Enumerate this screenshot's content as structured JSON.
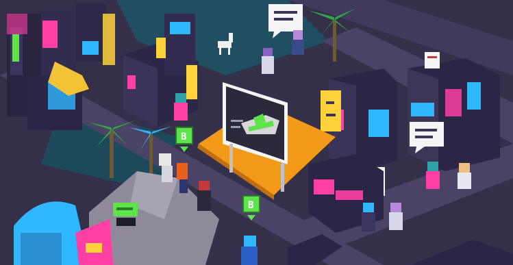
{
  "scene": {
    "style": "isometric pixel-art cyberpunk city",
    "palette": {
      "ground": "#3a3450",
      "road": "#4b4468",
      "water": "#1d4d5c",
      "building": "#2b2740",
      "building_light": "#3b3656",
      "neon_pink": "#ff3fa4",
      "neon_blue": "#2fb8ff",
      "neon_yellow": "#ffd23a",
      "neon_green": "#5ee34a",
      "stage_orange": "#f39a1b",
      "palm_green": "#2fa845",
      "rock": "#8f8a9a"
    }
  },
  "markers": [
    {
      "name": "b-marker-left",
      "label": "B",
      "color": "#5ee34a"
    },
    {
      "name": "b-marker-bottom",
      "label": "B",
      "color": "#5ee34a"
    }
  ],
  "billboard": {
    "icon": "sneaker-icon",
    "accent": "#5ee34a"
  },
  "speech_bubbles": [
    "bubble-top",
    "bubble-right-upper",
    "bubble-right-lower",
    "bubble-rooftop"
  ]
}
